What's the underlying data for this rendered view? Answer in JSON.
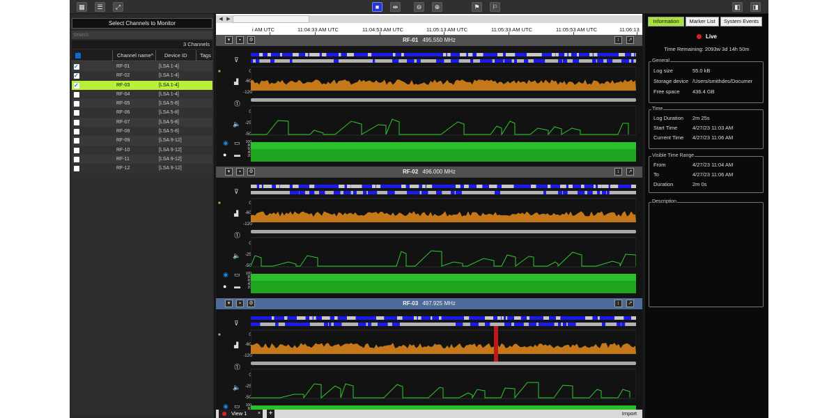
{
  "left_panel": {
    "header": "Select Channels to Monitor",
    "search_placeholder": "Search",
    "count_label": "3 Channels",
    "columns": {
      "name": "Channel name^",
      "device": "Device ID",
      "tags": "Tags"
    },
    "channels": [
      {
        "name": "RF-01",
        "device": "[LSA 1-4]",
        "checked": true,
        "selected": false
      },
      {
        "name": "RF-02",
        "device": "[LSA 1-4]",
        "checked": true,
        "selected": false
      },
      {
        "name": "RF-03",
        "device": "[LSA 1-4]",
        "checked": true,
        "selected": true
      },
      {
        "name": "RF-04",
        "device": "[LSA 1-4]",
        "checked": false,
        "selected": false
      },
      {
        "name": "RF-05",
        "device": "[LSA 5-8]",
        "checked": false,
        "selected": false
      },
      {
        "name": "RF-06",
        "device": "[LSA 5-8]",
        "checked": false,
        "selected": false
      },
      {
        "name": "RF-07",
        "device": "[LSA 5-8]",
        "checked": false,
        "selected": false
      },
      {
        "name": "RF-08",
        "device": "[LSA 5-8]",
        "checked": false,
        "selected": false
      },
      {
        "name": "RF-09",
        "device": "[LSA 9-12]",
        "checked": false,
        "selected": false
      },
      {
        "name": "RF-10",
        "device": "[LSA 9-12]",
        "checked": false,
        "selected": false
      },
      {
        "name": "RF-11",
        "device": "[LSA 9-12]",
        "checked": false,
        "selected": false
      },
      {
        "name": "RF-12",
        "device": "[LSA 9-12]",
        "checked": false,
        "selected": false
      }
    ]
  },
  "timeline": {
    "ticks": [
      "i AM UTC",
      "11:04:33 AM UTC",
      "11:04:53 AM UTC",
      "11:05:13 AM UTC",
      "11:05:33 AM UTC",
      "11:05:53 AM UTC",
      "11:06:13"
    ]
  },
  "channels_view": [
    {
      "name": "RF-01",
      "freq": "495.550 MHz",
      "selected": false
    },
    {
      "name": "RF-02",
      "freq": "496.000 MHz",
      "selected": false
    },
    {
      "name": "RF-03",
      "freq": "497.925 MHz",
      "selected": true
    }
  ],
  "lane_labels": {
    "rf_top": "0",
    "rf_mid": "-60",
    "rf_bottom": "-120",
    "audio_top": "0",
    "audio_mid": "-25",
    "audio_bottom": "-50",
    "batt": [
      "100",
      "80",
      "60",
      "40",
      "20"
    ]
  },
  "icons": {
    "filter": "filter-icon",
    "signal": "signal-strength-icon",
    "alert": "alert-icon",
    "audio": "speaker-icon",
    "battery": "battery-icon"
  },
  "tabs": {
    "view_label": "View 1",
    "close": "×",
    "add": "+",
    "import": "Import"
  },
  "right_panel": {
    "tabs": [
      "Information",
      "Marker List",
      "System Events"
    ],
    "live": "Live",
    "time_remaining": "Time Remaining: 2093w 3d 14h 50m",
    "general": {
      "title": "General",
      "rows": [
        {
          "k": "Log size",
          "v": "55.0 kB"
        },
        {
          "k": "Storage device",
          "v": "/Users/smithdes/Documer"
        },
        {
          "k": "Free space",
          "v": "436.4 GB"
        }
      ]
    },
    "time": {
      "title": "Time",
      "rows": [
        {
          "k": "Log Duration",
          "v": "2m 25s"
        },
        {
          "k": "Start Time",
          "v": "4/27/23 11:03 AM"
        },
        {
          "k": "Current Time",
          "v": "4/27/23 11:06 AM"
        }
      ]
    },
    "visible": {
      "title": "Visible Time Range",
      "rows": [
        {
          "k": "From",
          "v": "4/27/23 11:04 AM"
        },
        {
          "k": "To",
          "v": "4/27/23 11:06 AM"
        },
        {
          "k": "Duration",
          "v": "2m 0s"
        }
      ]
    },
    "description": {
      "title": "Description"
    }
  },
  "colors": {
    "accent_green": "#a8e23b",
    "rf_orange": "#d9841c",
    "audio_green": "#2ecb2e",
    "battery_green": "#1fa51f",
    "activity_blue": "#1a1aef",
    "live_red": "#e01c1c"
  }
}
